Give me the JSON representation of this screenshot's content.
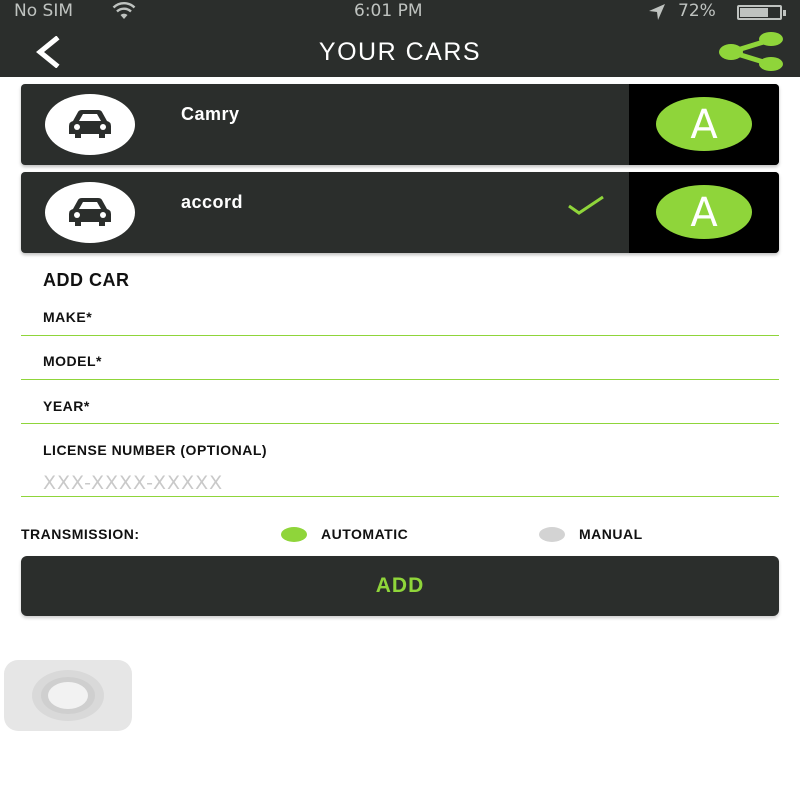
{
  "status_bar": {
    "carrier": "No SIM",
    "time": "6:01 PM",
    "battery": "72%",
    "battery_level": 0.72
  },
  "header": {
    "title": "YOUR CARS",
    "back_icon": "chevron-left-icon",
    "share_icon": "share-icon"
  },
  "cars": [
    {
      "name": "Camry",
      "transmission": "A",
      "selected": false
    },
    {
      "name": "accord",
      "transmission": "A",
      "selected": true
    }
  ],
  "add_car": {
    "title": "ADD CAR",
    "make_label": "MAKE*",
    "model_label": "MODEL*",
    "year_label": "YEAR*",
    "license_label": "LICENSE NUMBER (OPTIONAL)",
    "license_placeholder": "XXX-XXXX-XXXXX",
    "transmission_label": "TRANSMISSION:",
    "automatic_label": "AUTOMATIC",
    "manual_label": "MANUAL",
    "selected_transmission": "AUTOMATIC",
    "add_button": "ADD"
  },
  "colors": {
    "accent": "#8fd53a",
    "dark": "#2b2e2c",
    "radio_off": "#d3d3d3"
  }
}
